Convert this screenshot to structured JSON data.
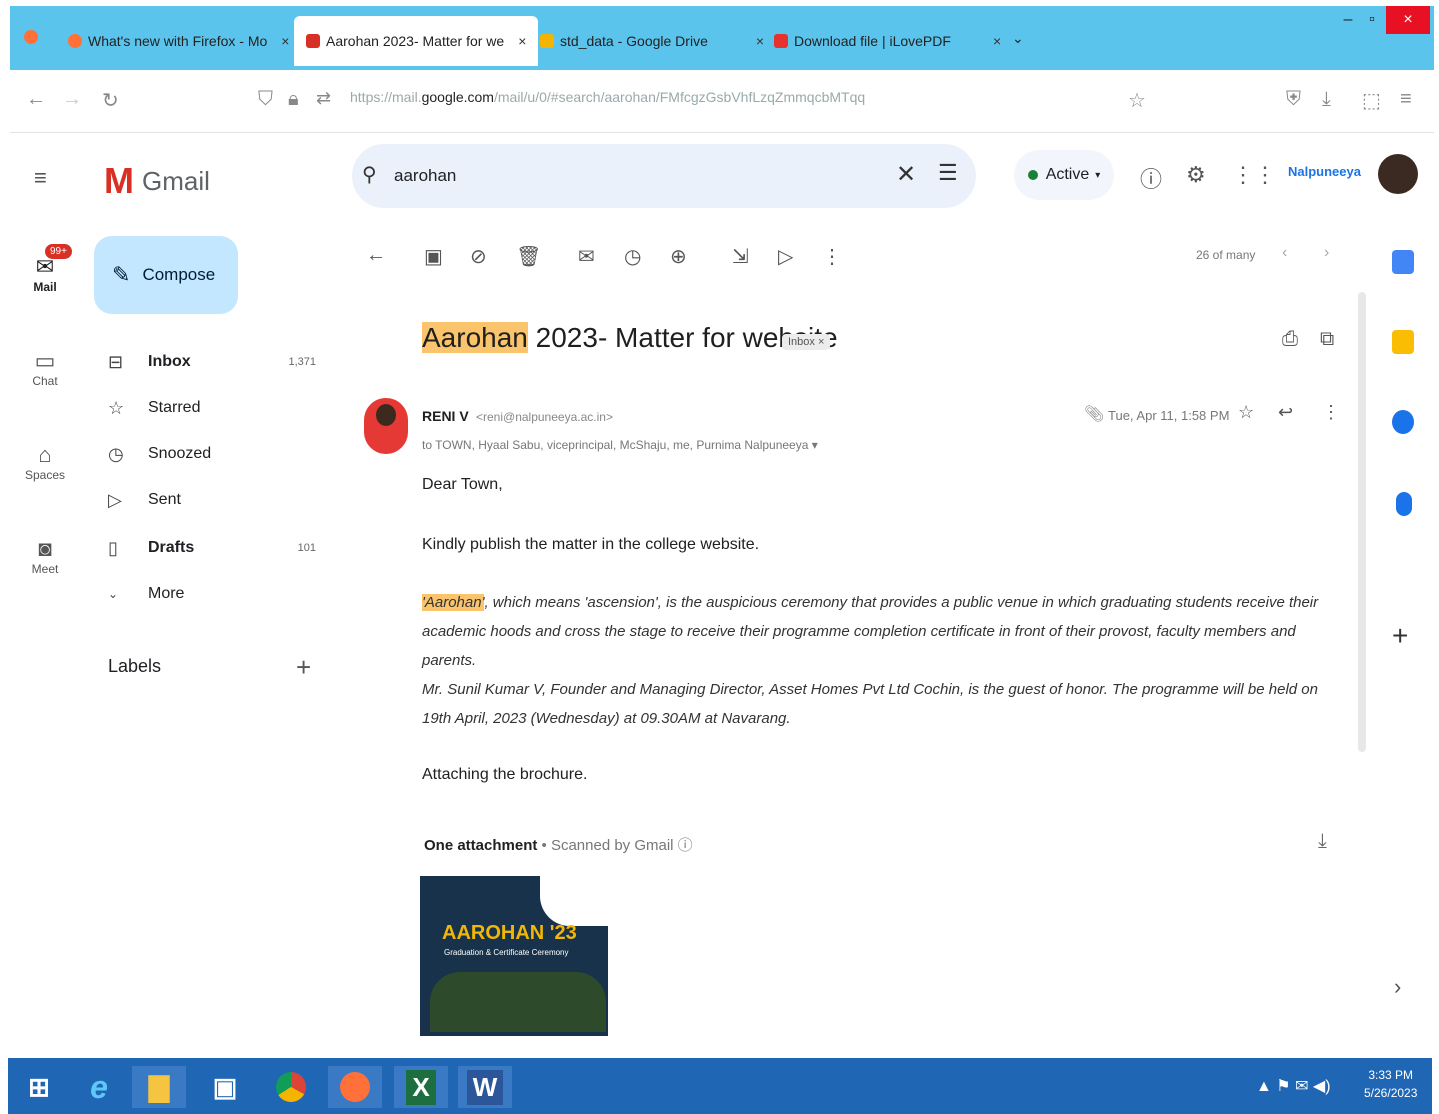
{
  "browser": {
    "tabs": [
      {
        "label": "What's new with Firefox - Mo",
        "close": "×"
      },
      {
        "label": "Aarohan 2023- Matter for we",
        "close": "×"
      },
      {
        "label": "std_data - Google Drive",
        "close": "×"
      },
      {
        "label": "Download file | iLovePDF",
        "close": "×"
      }
    ],
    "new_tab": "⌄",
    "url_prefix": "https://mail.",
    "url_domain": "google.com",
    "url_rest": "/mail/u/0/#search/aarohan/FMfcgzGsbVhfLzqZmmqcbMTqq",
    "accent": "#5bc4ec"
  },
  "rail": {
    "badge": "99+",
    "items": [
      {
        "label": "Mail"
      },
      {
        "label": "Chat"
      },
      {
        "label": "Spaces"
      },
      {
        "label": "Meet"
      }
    ]
  },
  "header": {
    "logo_text": "Gmail",
    "search_value": "aarohan",
    "status": "Active",
    "org_logo": "Nalpuneeya"
  },
  "nav": {
    "compose": "Compose",
    "items": [
      {
        "label": "Inbox",
        "count": "1,371"
      },
      {
        "label": "Starred",
        "count": ""
      },
      {
        "label": "Snoozed",
        "count": ""
      },
      {
        "label": "Sent",
        "count": ""
      },
      {
        "label": "Drafts",
        "count": "101"
      },
      {
        "label": "More",
        "count": ""
      }
    ],
    "labels_title": "Labels",
    "labels_add": "+"
  },
  "toolbar": {
    "pager": "26 of many"
  },
  "message": {
    "subject_highlight": "Aarohan",
    "subject_rest": " 2023- Matter for website",
    "inbox_chip": "Inbox ×",
    "sender_name": "RENI V",
    "sender_email": "<reni@nalpuneeya.ac.in>",
    "recipients": "to TOWN, Hyaal Sabu, viceprincipal, McShaju, me, Purnima Nalpuneeya ▾",
    "date": "Tue, Apr 11, 1:58 PM",
    "greeting": "Dear Town,",
    "line1": "Kindly publish the matter in the college website.",
    "para_highlight": "'Aarohan'",
    "para_rest": ", which means 'ascension', is the auspicious ceremony that provides a public venue in which graduating students receive their academic hoods and cross the stage to receive their programme completion certificate in front of their provost, faculty members and parents.",
    "para2": "Mr. Sunil Kumar V, Founder and Managing Director, Asset Homes Pvt Ltd Cochin, is the guest of honor.  The programme will be held on 19th April, 2023 (Wednesday) at 09.30AM at Navarang.",
    "closing": "Attaching the brochure.",
    "attachment_title": "One attachment",
    "attachment_scan": " • Scanned by Gmail ⓘ",
    "thumb_title": "AAROHAN '23",
    "thumb_sub": "Graduation & Certificate Ceremony",
    "highlight_color": "#f9c46b"
  },
  "taskbar": {
    "clock_time": "3:33 PM",
    "clock_date": "5/26/2023",
    "tray": "▲ ⚑ ✉ ◀)"
  }
}
